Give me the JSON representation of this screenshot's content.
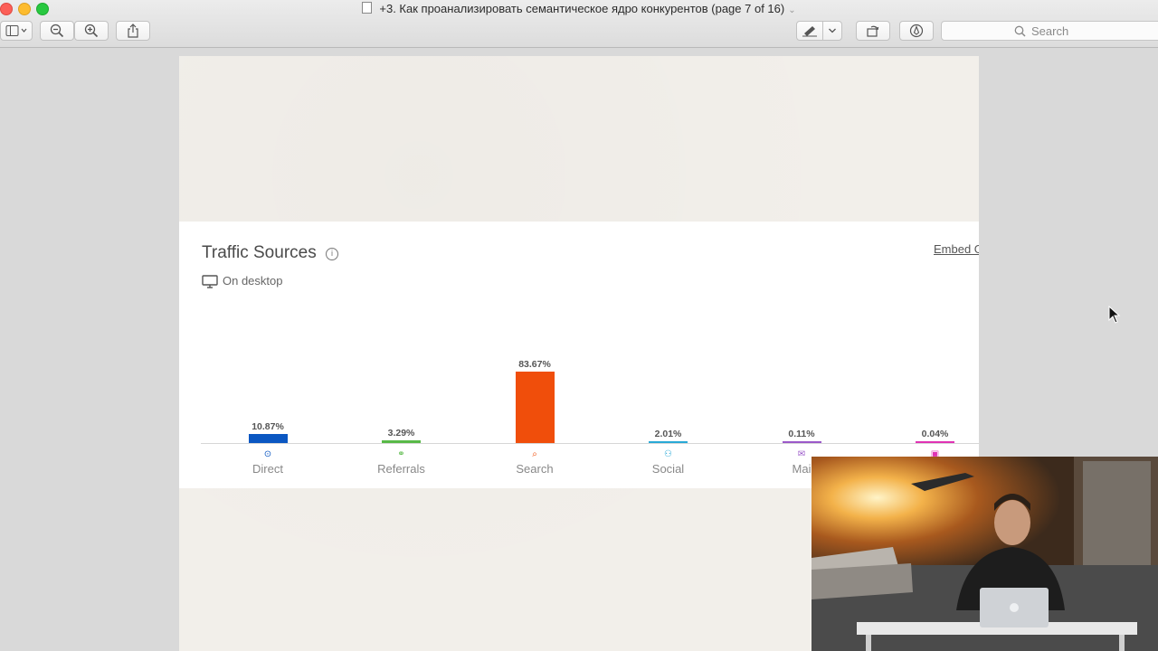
{
  "window": {
    "title": "+3. Как проанализировать семантическое ядро конкурентов (page 7 of 16)"
  },
  "toolbar": {
    "search_placeholder": "Search"
  },
  "widget": {
    "title": "Traffic Sources",
    "subtitle": "On desktop",
    "embed_link": "Embed G"
  },
  "chart_data": {
    "type": "bar",
    "title": "Traffic Sources",
    "subtitle": "On desktop",
    "unit": "%",
    "ylim": [
      0,
      100
    ],
    "categories": [
      "Direct",
      "Referrals",
      "Search",
      "Social",
      "Mail",
      ""
    ],
    "values": [
      10.87,
      3.29,
      83.67,
      2.01,
      0.11,
      0.04
    ],
    "value_labels": [
      "10.87%",
      "3.29%",
      "83.67%",
      "2.01%",
      "0.11%",
      "0.04%"
    ],
    "category_labels_visible": [
      "Direct",
      "Referrals",
      "Search",
      "Social",
      "Mai",
      ""
    ],
    "colors": [
      "#0b57c2",
      "#58b947",
      "#f04e0b",
      "#29a9d6",
      "#9b59c9",
      "#e033b4"
    ],
    "icons": [
      "direct-icon",
      "referrals-link-icon",
      "search-icon",
      "social-people-icon",
      "mail-icon",
      "display-ad-icon"
    ],
    "grid": false
  }
}
